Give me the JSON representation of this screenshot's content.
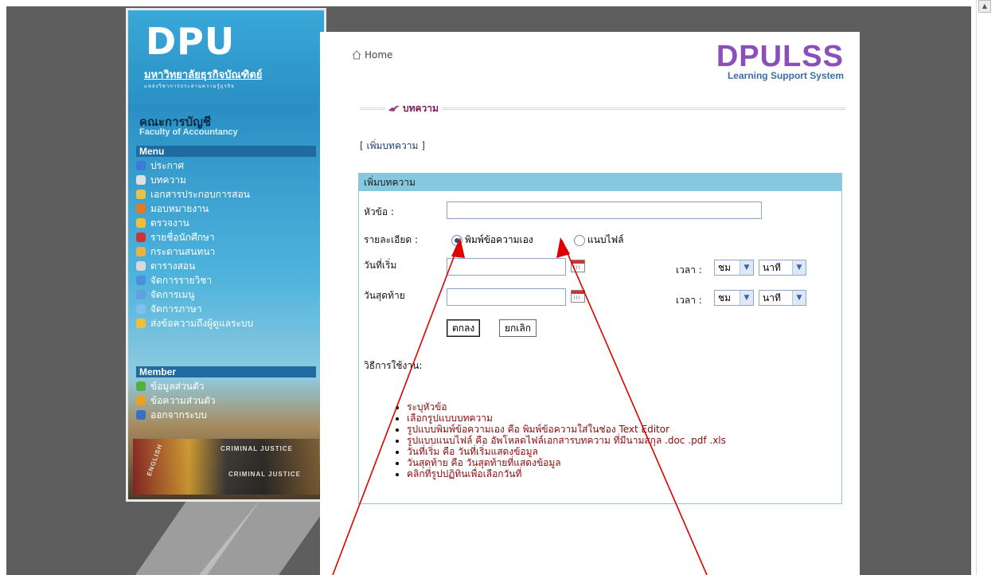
{
  "sidebar": {
    "logo_big": "DPU",
    "logo_university": "มหาวิทยาลัยธุรกิจบัณฑิตย์",
    "logo_tagline": "แหล่งวิชาการประสานความรู้ธุรกิจ",
    "faculty_th": "คณะการบัญชี",
    "faculty_en": "Faculty of Accountancy",
    "menu_header": "Menu",
    "menu_items": [
      {
        "label": "ประกาศ",
        "icon": "megaphone-icon",
        "color": "#3a7bd5"
      },
      {
        "label": "บทความ",
        "icon": "article-icon",
        "color": "#e0e0e0"
      },
      {
        "label": "เอกสารประกอบการสอน",
        "icon": "documents-icon",
        "color": "#e8c24a"
      },
      {
        "label": "มอบหมายงาน",
        "icon": "assignment-icon",
        "color": "#e07a2a"
      },
      {
        "label": "ตรวจงาน",
        "icon": "check-work-icon",
        "color": "#f0c030"
      },
      {
        "label": "รายชื่อนักศึกษา",
        "icon": "student-list-icon",
        "color": "#d83030"
      },
      {
        "label": "กระดานสนทนา",
        "icon": "forum-icon",
        "color": "#f0b040"
      },
      {
        "label": "ตารางสอน",
        "icon": "timetable-icon",
        "color": "#d8d8d8"
      },
      {
        "label": "จัดการรายวิชา",
        "icon": "course-icon",
        "color": "#4a90e0"
      },
      {
        "label": "จัดการเมนู",
        "icon": "menu-manage-icon",
        "color": "#60a0e0"
      },
      {
        "label": "จัดการภาษา",
        "icon": "language-icon",
        "color": "#80c0f0"
      },
      {
        "label": "ส่งข้อความถึงผู้ดูแลระบบ",
        "icon": "message-admin-icon",
        "color": "#f0c030"
      }
    ],
    "member_header": "Member",
    "member_items": [
      {
        "label": "ข้อมูลส่วนตัว",
        "icon": "profile-icon",
        "color": "#50b040"
      },
      {
        "label": "ข้อความส่วนตัว",
        "icon": "private-message-icon",
        "color": "#f0a020"
      },
      {
        "label": "ออกจากระบบ",
        "icon": "logout-icon",
        "color": "#3a70c0"
      }
    ],
    "book_label_1": "CRIMINAL JUSTICE",
    "book_label_2": "CRIMINAL JUSTICE",
    "book_label_3": "ENGLISH"
  },
  "header": {
    "home_label": "Home",
    "brand_big": "DPULSS",
    "brand_small": "Learning Support System"
  },
  "section": {
    "title": "บทความ",
    "add_link": "เพิ่มบทความ"
  },
  "form": {
    "title": "เพิ่มบทความ",
    "subject_label": "หัวข้อ :",
    "subject_value": "",
    "detail_label": "รายละเอียด :",
    "radio_type_label": "พิมพ์ข้อความเอง",
    "radio_file_label": "แนบไฟล์",
    "start_date_label": "วันที่เริ่ม",
    "start_date_value": "",
    "end_date_label": "วันสุดท้าย",
    "end_date_value": "",
    "time_label": "เวลา :",
    "hour_option": "ชม",
    "minute_option": "นาที",
    "ok_button": "ตกลง",
    "cancel_button": "ยกเลิก",
    "instructions_title": "วิธีการใช้งาน:",
    "instructions": [
      "ระบุหัวข้อ",
      "เลือกรูปแบบบทความ",
      "รูปแบบพิมพ์ข้อความเอง คือ พิมพ์ข้อความใส่ในช่อง Text Editor",
      "รูปแบบแนบไฟล์ คือ อัพโหลดไฟล์เอกสารบทความ ที่มีนามสกุล .doc .pdf .xls",
      "วันที่เริ่ม คือ วันที่เริ่มแสดงข้อมูล",
      "วันสุดท้าย คือ วันสุดท้ายที่แสดงข้อมูล",
      "คลิกที่รูปปฏิทินเพื่อเลือกวันที่"
    ]
  },
  "colors": {
    "frame_bg": "#5e5e5e",
    "form_header": "#88c8de",
    "instruction_text": "#8b0a0a",
    "annotation_arrow": "#e00000"
  }
}
